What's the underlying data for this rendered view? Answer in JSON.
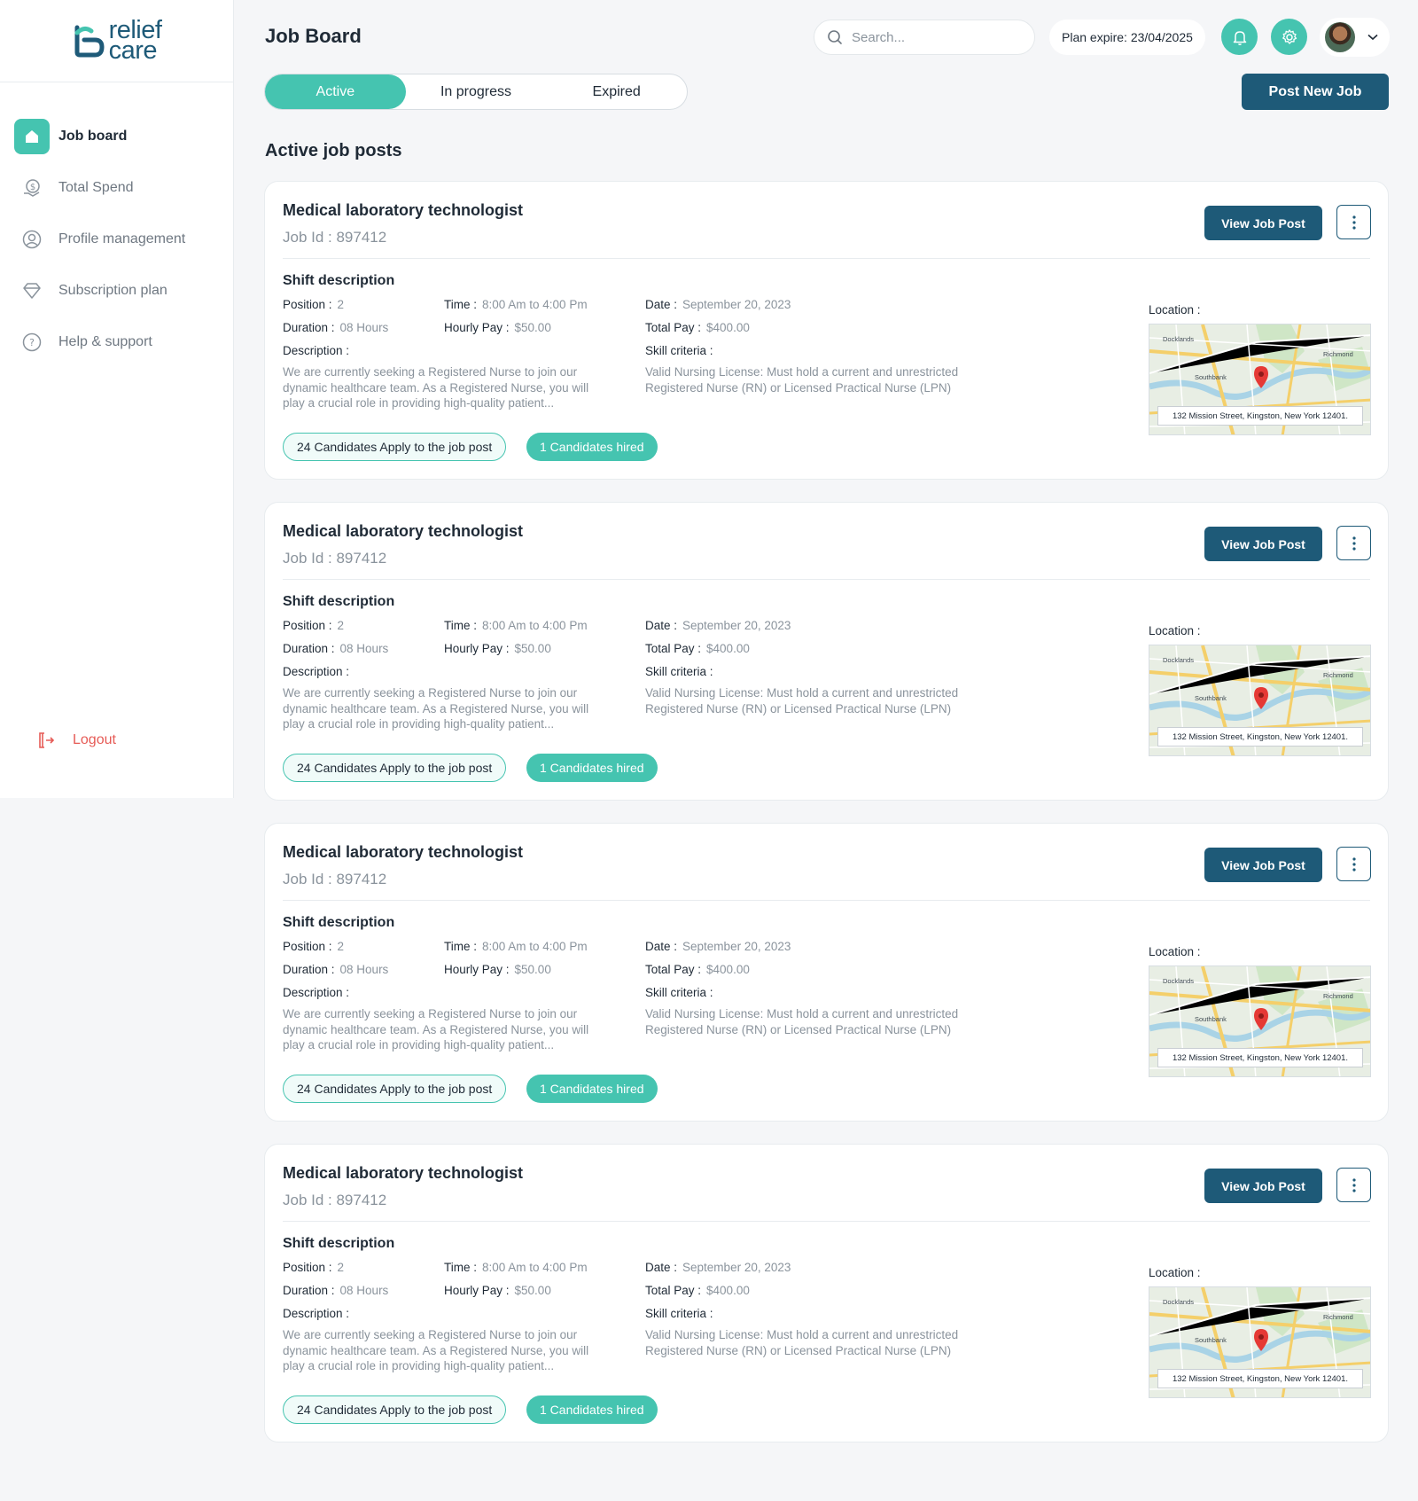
{
  "brand": {
    "name_top": "relief",
    "name_bottom": "care"
  },
  "sidebar": {
    "items": [
      {
        "label": "Job board",
        "icon": "home-icon",
        "active": true
      },
      {
        "label": "Total Spend",
        "icon": "dollar-icon",
        "active": false
      },
      {
        "label": "Profile management",
        "icon": "user-icon",
        "active": false
      },
      {
        "label": "Subscription plan",
        "icon": "diamond-icon",
        "active": false
      },
      {
        "label": "Help & support",
        "icon": "help-icon",
        "active": false
      }
    ],
    "logout_label": "Logout"
  },
  "header": {
    "title": "Job Board",
    "search_placeholder": "Search...",
    "plan_expire": "Plan expire: 23/04/2025"
  },
  "tabs": [
    {
      "label": "Active",
      "active": true
    },
    {
      "label": "In progress",
      "active": false
    },
    {
      "label": "Expired",
      "active": false
    }
  ],
  "post_button": "Post New Job",
  "section_title": "Active job posts",
  "job_labels": {
    "shift_title": "Shift description",
    "position": "Position :",
    "duration": "Duration :",
    "time": "Time :",
    "hourly_pay": "Hourly Pay :",
    "date": "Date :",
    "total_pay": "Total Pay :",
    "description": "Description :",
    "skill_criteria": "Skill criteria :",
    "location": "Location :",
    "view_button": "View Job Post"
  },
  "jobs": [
    {
      "title": "Medical laboratory technologist",
      "job_id": "Job Id : 897412",
      "position": "2",
      "duration": "08 Hours",
      "time": "8:00 Am to 4:00 Pm",
      "hourly_pay": "$50.00",
      "date": "September 20, 2023",
      "total_pay": "$400.00",
      "description": "We are currently seeking a Registered Nurse to join our dynamic healthcare team. As a Registered Nurse, you will play a crucial role in providing high-quality patient...",
      "skill_criteria": "Valid Nursing License: Must hold a current and unrestricted Registered Nurse (RN) or Licensed Practical Nurse (LPN)",
      "candidates_applied": "24 Candidates Apply to the job post",
      "candidates_hired": "1 Candidates hired",
      "address": "132 Mission Street, Kingston, New York 12401.",
      "map_labels": [
        "Docklands",
        "Richmond",
        "Southbank"
      ]
    },
    {
      "title": "Medical laboratory technologist",
      "job_id": "Job Id : 897412",
      "position": "2",
      "duration": "08 Hours",
      "time": "8:00 Am to 4:00 Pm",
      "hourly_pay": "$50.00",
      "date": "September 20, 2023",
      "total_pay": "$400.00",
      "description": "We are currently seeking a Registered Nurse to join our dynamic healthcare team. As a Registered Nurse, you will play a crucial role in providing high-quality patient...",
      "skill_criteria": "Valid Nursing License: Must hold a current and unrestricted Registered Nurse (RN) or Licensed Practical Nurse (LPN)",
      "candidates_applied": "24 Candidates Apply to the job post",
      "candidates_hired": "1 Candidates hired",
      "address": "132 Mission Street, Kingston, New York 12401.",
      "map_labels": [
        "Docklands",
        "Richmond",
        "Southbank"
      ]
    },
    {
      "title": "Medical laboratory technologist",
      "job_id": "Job Id : 897412",
      "position": "2",
      "duration": "08 Hours",
      "time": "8:00 Am to 4:00 Pm",
      "hourly_pay": "$50.00",
      "date": "September 20, 2023",
      "total_pay": "$400.00",
      "description": "We are currently seeking a Registered Nurse to join our dynamic healthcare team. As a Registered Nurse, you will play a crucial role in providing high-quality patient...",
      "skill_criteria": "Valid Nursing License: Must hold a current and unrestricted Registered Nurse (RN) or Licensed Practical Nurse (LPN)",
      "candidates_applied": "24 Candidates Apply to the job post",
      "candidates_hired": "1 Candidates hired",
      "address": "132 Mission Street, Kingston, New York 12401.",
      "map_labels": [
        "Docklands",
        "Richmond",
        "Southbank"
      ]
    },
    {
      "title": "Medical laboratory technologist",
      "job_id": "Job Id : 897412",
      "position": "2",
      "duration": "08 Hours",
      "time": "8:00 Am to 4:00 Pm",
      "hourly_pay": "$50.00",
      "date": "September 20, 2023",
      "total_pay": "$400.00",
      "description": "We are currently seeking a Registered Nurse to join our dynamic healthcare team. As a Registered Nurse, you will play a crucial role in providing high-quality patient...",
      "skill_criteria": "Valid Nursing License: Must hold a current and unrestricted Registered Nurse (RN) or Licensed Practical Nurse (LPN)",
      "candidates_applied": "24 Candidates Apply to the job post",
      "candidates_hired": "1 Candidates hired",
      "address": "132 Mission Street, Kingston, New York 12401.",
      "map_labels": [
        "Docklands",
        "Richmond",
        "Southbank"
      ]
    }
  ],
  "colors": {
    "accent": "#45c4b0",
    "primary": "#1e5a78",
    "danger": "#e65b56",
    "muted": "#8a939c"
  }
}
